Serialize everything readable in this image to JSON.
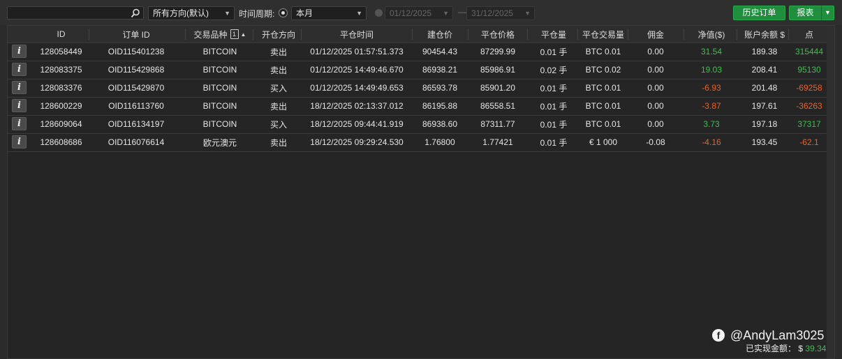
{
  "toolbar": {
    "search_placeholder": "",
    "direction_select": "所有方向(默认)",
    "period_label": "时间周期:",
    "period_select": "本月",
    "date_from": "01/12/2025",
    "date_to": "31/12/2025",
    "date_separator": "—",
    "history_button": "历史订单",
    "report_button": "报表"
  },
  "table": {
    "columns": [
      "ID",
      "订单 ID",
      "交易品种",
      "开仓方向",
      "平仓时间",
      "建仓价",
      "平仓价格",
      "平仓量",
      "平仓交易量",
      "佣金",
      "净值($)",
      "账户余额 $",
      "点"
    ],
    "sort_badge": "1",
    "sort_arrow": "▲",
    "info_label": "i",
    "rows": [
      {
        "id": "128058449",
        "order_id": "OID115401238",
        "symbol": "BITCOIN",
        "direction": "卖出",
        "close_time": "01/12/2025 01:57:51.373",
        "open_price": "90454.43",
        "close_price": "87299.99",
        "volume": "0.01 手",
        "trade_volume": "BTC 0.01",
        "commission": "0.00",
        "net": "31.54",
        "balance": "189.38",
        "points": "315444",
        "sign": "pos"
      },
      {
        "id": "128083375",
        "order_id": "OID115429868",
        "symbol": "BITCOIN",
        "direction": "卖出",
        "close_time": "01/12/2025 14:49:46.670",
        "open_price": "86938.21",
        "close_price": "85986.91",
        "volume": "0.02 手",
        "trade_volume": "BTC 0.02",
        "commission": "0.00",
        "net": "19.03",
        "balance": "208.41",
        "points": "95130",
        "sign": "pos"
      },
      {
        "id": "128083376",
        "order_id": "OID115429870",
        "symbol": "BITCOIN",
        "direction": "买入",
        "close_time": "01/12/2025 14:49:49.653",
        "open_price": "86593.78",
        "close_price": "85901.20",
        "volume": "0.01 手",
        "trade_volume": "BTC 0.01",
        "commission": "0.00",
        "net": "-6.93",
        "balance": "201.48",
        "points": "-69258",
        "sign": "neg"
      },
      {
        "id": "128600229",
        "order_id": "OID116113760",
        "symbol": "BITCOIN",
        "direction": "卖出",
        "close_time": "18/12/2025 02:13:37.012",
        "open_price": "86195.88",
        "close_price": "86558.51",
        "volume": "0.01 手",
        "trade_volume": "BTC 0.01",
        "commission": "0.00",
        "net": "-3.87",
        "balance": "197.61",
        "points": "-36263",
        "sign": "neg"
      },
      {
        "id": "128609064",
        "order_id": "OID116134197",
        "symbol": "BITCOIN",
        "direction": "买入",
        "close_time": "18/12/2025 09:44:41.919",
        "open_price": "86938.60",
        "close_price": "87311.77",
        "volume": "0.01 手",
        "trade_volume": "BTC 0.01",
        "commission": "0.00",
        "net": "3.73",
        "balance": "197.18",
        "points": "37317",
        "sign": "pos"
      },
      {
        "id": "128608686",
        "order_id": "OID116076614",
        "symbol": "欧元澳元",
        "direction": "卖出",
        "close_time": "18/12/2025 09:29:24.530",
        "open_price": "1.76800",
        "close_price": "1.77421",
        "volume": "0.01 手",
        "trade_volume": "€ 1 000",
        "commission": "-0.08",
        "net": "-4.16",
        "balance": "193.45",
        "points": "-62.1",
        "sign": "neg"
      }
    ]
  },
  "watermark": {
    "icon": "facebook-icon",
    "handle": "@AndyLam3025"
  },
  "footer": {
    "realized_label": "已实现金额：",
    "currency": "$",
    "realized_value": "39.34"
  },
  "colors": {
    "positive": "#3fbf4f",
    "negative": "#e8622a",
    "accent": "#1f8f3e"
  }
}
